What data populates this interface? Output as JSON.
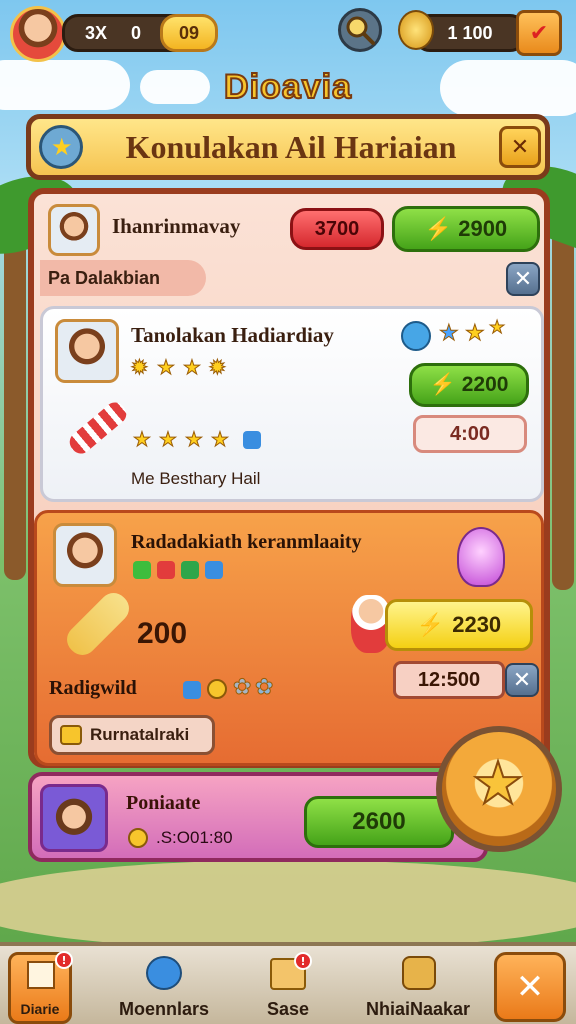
{
  "topbar": {
    "level_value": "3X",
    "coins_value": "0",
    "gems_value": "09",
    "trophy_value": "1 100"
  },
  "header": {
    "title": "Dioavia",
    "banner_title": "Konulakan Ail Hariaian"
  },
  "section1": {
    "title": "Ihanrinmavay",
    "red_button": "3700",
    "green_button": "2900",
    "sub_label": "Pa Dalakbian"
  },
  "card_white": {
    "title": "Tanolakan Hadiardiay",
    "green_button": "2200",
    "cream_button": "4:00",
    "footer_label": "Me Besthary Hail"
  },
  "card_orange": {
    "title": "Radadakiath keranmlaaity",
    "amount": "200",
    "yellow_button": "2230",
    "timer_button": "12:500",
    "sub_label": "Radigwild",
    "small_button": "Rurnatalraki"
  },
  "card_pink": {
    "title": "Poniaate",
    "coins_text": ".S:O01:80",
    "green_button": "2600"
  },
  "bottom_nav": [
    {
      "label": "Diarie"
    },
    {
      "label": "Moennlars"
    },
    {
      "label": "Sase"
    },
    {
      "label": "NhiaiNaakar"
    }
  ],
  "colors": {
    "accent_gold": "#f7c52c",
    "panel_border": "#9a3c1e",
    "green": "#45a319",
    "red": "#d5282e"
  }
}
